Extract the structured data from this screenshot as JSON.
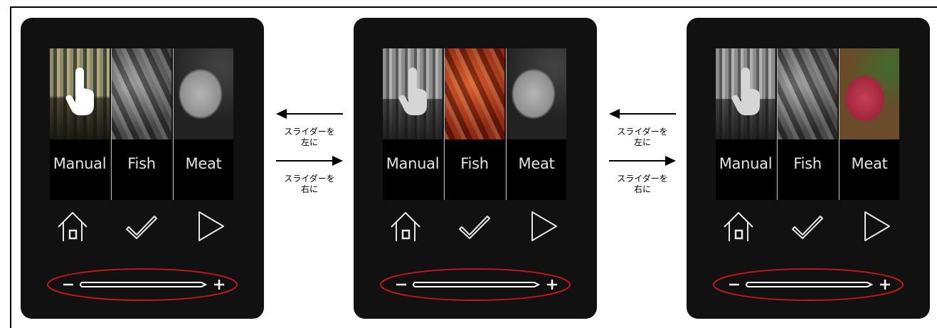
{
  "instructions": {
    "slide_left": "スライダーを\n左に",
    "slide_right": "スライダーを\n右に"
  },
  "panels": [
    {
      "selected": "Manual",
      "tiles": [
        {
          "label": "Manual",
          "active": true
        },
        {
          "label": "Fish",
          "active": false
        },
        {
          "label": "Meat",
          "active": false
        }
      ],
      "hand_tile": "Manual"
    },
    {
      "selected": "Fish",
      "tiles": [
        {
          "label": "Manual",
          "active": false
        },
        {
          "label": "Fish",
          "active": true
        },
        {
          "label": "Meat",
          "active": false
        }
      ],
      "hand_tile": "Manual"
    },
    {
      "selected": "Meat",
      "tiles": [
        {
          "label": "Manual",
          "active": false
        },
        {
          "label": "Fish",
          "active": false
        },
        {
          "label": "Meat",
          "active": true
        }
      ],
      "hand_tile": "Manual"
    }
  ],
  "controls": {
    "home_icon": "home-icon",
    "confirm_icon": "checkmark-icon",
    "start_icon": "play-icon",
    "slider_minus": "−",
    "slider_plus": "+"
  },
  "colors": {
    "panel": "#111111",
    "highlight_ring": "#c0161c",
    "icon_stroke": "#e8e8e8"
  }
}
